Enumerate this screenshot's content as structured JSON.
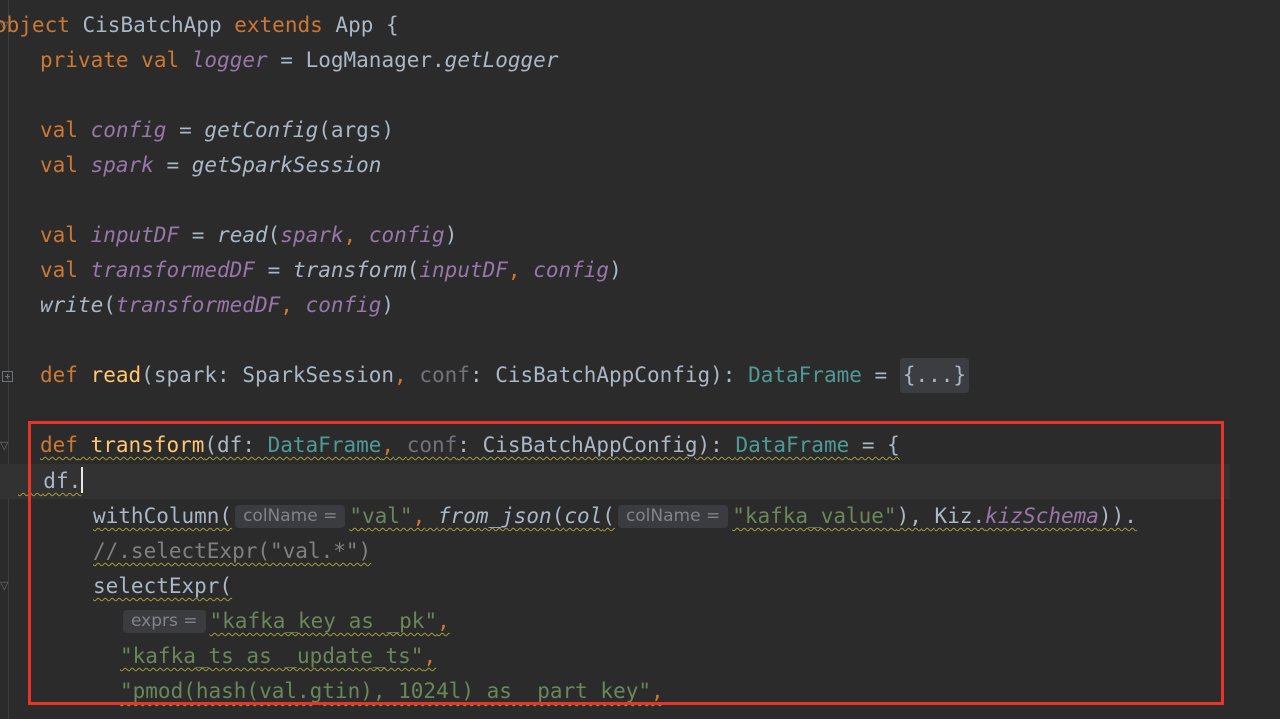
{
  "code": {
    "line1": {
      "object_kw": "object",
      "class_name": "CisBatchApp",
      "extends_kw": "extends",
      "parent": "App",
      "brace": "{"
    },
    "line2": {
      "private_kw": "private",
      "val_kw": "val",
      "name": "logger",
      "op": "=",
      "target": "LogManager.",
      "method": "getLogger"
    },
    "line3": {
      "val_kw": "val",
      "name": "config",
      "op": "=",
      "call": "getConfig",
      "args": "(args)"
    },
    "line4": {
      "val_kw": "val",
      "name": "spark",
      "op": "=",
      "call": "getSparkSession"
    },
    "line5": {
      "val_kw": "val",
      "name": "inputDF",
      "op": "=",
      "call": "read",
      "open": "(",
      "arg1": "spark",
      "comma": ",",
      "arg2": "config",
      "close": ")"
    },
    "line6": {
      "val_kw": "val",
      "name": "transformedDF",
      "op": "=",
      "call": "transform",
      "open": "(",
      "arg1": "inputDF",
      "comma": ",",
      "arg2": "config",
      "close": ")"
    },
    "line7": {
      "call": "write",
      "open": "(",
      "arg1": "transformedDF",
      "comma": ",",
      "arg2": "config",
      "close": ")"
    },
    "line8": {
      "def_kw": "def",
      "fn_name": "read",
      "p1": "(spark: SparkSession",
      "comma": ",",
      "p2": "conf",
      "p2_type": ": CisBatchAppConfig): ",
      "ret_type": "DataFrame",
      "eq": " = ",
      "folded": "{...}"
    },
    "line9": {
      "def_kw": "def",
      "fn_name": "transform",
      "p1_open": "(df: ",
      "p1_type": "DataFrame",
      "comma": ",",
      "p2": "conf",
      "p2_type": ": CisBatchAppConfig): ",
      "ret_type": "DataFrame",
      "eq": " = {"
    },
    "line10": {
      "text": "df."
    },
    "line11": {
      "call": "withColumn(",
      "hint1": "colName =",
      "str1": "\"val\"",
      "comma": ",",
      "fn2": "from_json",
      "open2": "(",
      "fn3": "col",
      "open3": "(",
      "hint2": "colName =",
      "str2": "\"kafka_value\"",
      "close": "),",
      "obj": "Kiz.",
      "field": "kizSchema",
      "end": ")).",
      "plain_sp": " "
    },
    "line12": {
      "comment": "//.selectExpr(\"val.*\")"
    },
    "line13": {
      "call": "selectExpr("
    },
    "line14": {
      "hint": "exprs =",
      "str": "\"kafka_key as _pk\"",
      "comma": ","
    },
    "line15": {
      "str": "\"kafka_ts as _update_ts\"",
      "comma": ","
    },
    "line16": {
      "str": "\"pmod(hash(val.gtin), 1024l) as _part_key\"",
      "comma": ","
    }
  },
  "colors": {
    "background": "#2b2b2b",
    "keyword": "#cc7832",
    "field": "#9876aa",
    "function_def": "#ffc66d",
    "type": "#4e9a97",
    "string": "#6a8759",
    "comment": "#808080",
    "highlight_box": "#e8352a"
  }
}
